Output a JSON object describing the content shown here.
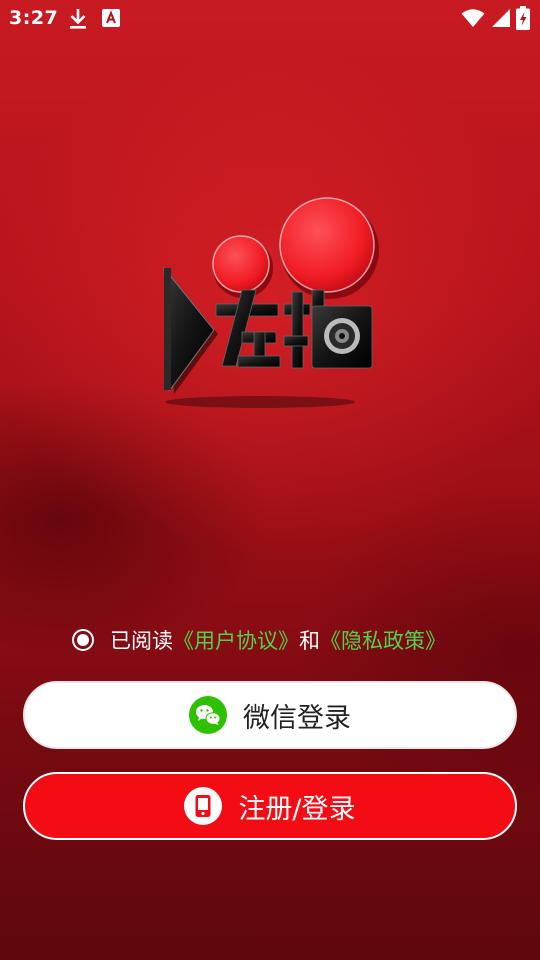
{
  "status_bar": {
    "time": "3:27",
    "icons": [
      "download-icon",
      "app-a-icon",
      "wifi-icon",
      "signal-icon",
      "battery-charging-icon"
    ]
  },
  "logo": {
    "text": "左拍",
    "icon": "left-pai-logo"
  },
  "agreement": {
    "checked": true,
    "prefix": "已阅读",
    "user_agreement": "《用户协议》",
    "conjunction": "和",
    "privacy_policy": "《隐私政策》"
  },
  "buttons": {
    "wechat_login": {
      "label": "微信登录",
      "icon": "wechat-icon"
    },
    "register_login": {
      "label": "注册/登录",
      "icon": "phone-icon"
    }
  },
  "colors": {
    "background": "#b5131b",
    "link": "#4fd34f",
    "primary_button": "#f30c14",
    "wechat_green": "#2dc100"
  }
}
